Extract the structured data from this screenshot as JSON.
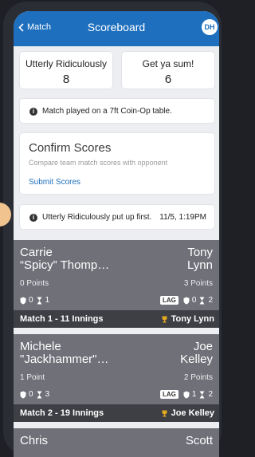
{
  "nav": {
    "back_label": "Match",
    "title": "Scoreboard",
    "avatar_initials": "DH"
  },
  "teams": [
    {
      "name": "Utterly Ridiculously",
      "score": "8"
    },
    {
      "name": "Get ya sum!",
      "score": "6"
    }
  ],
  "table_info": "Match played on a 7ft Coin-Op table.",
  "confirm": {
    "title": "Confirm Scores",
    "subtitle": "Compare team match scores with opponent",
    "submit_label": "Submit Scores"
  },
  "put_up": {
    "text": "Utterly Ridiculously put up first.",
    "time": "11/5, 1:19PM"
  },
  "matches": [
    {
      "left": {
        "name_line1": "Carrie",
        "name_line2": "“Spicy” Thomp…",
        "points": "0 Points",
        "defense": "0",
        "timeouts": "1"
      },
      "right": {
        "name_line1": "Tony",
        "name_line2": "Lynn",
        "points": "3 Points",
        "lag": "LAG",
        "defense": "0",
        "timeouts": "2"
      },
      "footer": "Match 1 - 11 Innings",
      "winner": "Tony Lynn"
    },
    {
      "left": {
        "name_line1": "Michele",
        "name_line2": "\"Jackhammer\"…",
        "points": "1 Point",
        "defense": "0",
        "timeouts": "3"
      },
      "right": {
        "name_line1": "Joe",
        "name_line2": "Kelley",
        "points": "2 Points",
        "lag": "LAG",
        "defense": "1",
        "timeouts": "2"
      },
      "footer": "Match 2 - 19 Innings",
      "winner": "Joe Kelley"
    },
    {
      "left": {
        "name_line1": "Chris"
      },
      "right": {
        "name_line1": "Scott"
      }
    }
  ],
  "colors": {
    "nav_blue": "#1e6fbe",
    "card_gray": "#6f7078",
    "footer_dark": "#3e3f45",
    "trophy_gold": "#e2a81f"
  }
}
